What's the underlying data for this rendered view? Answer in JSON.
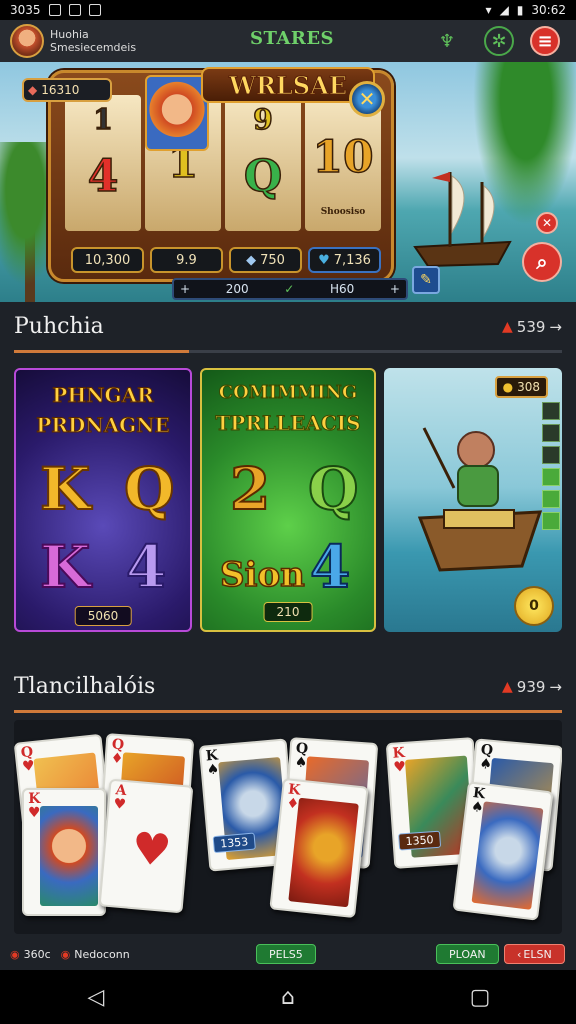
{
  "status_bar": {
    "time_left": "3035",
    "time_right": "30:62"
  },
  "header": {
    "user_name": "Huohia",
    "user_sub": "Smesiecemdeis",
    "brand": "STARES",
    "icons": {
      "trophy": "trophy-icon",
      "settings": "gear-icon",
      "menu": "hamburger-icon"
    }
  },
  "hero": {
    "title": "WRLSAE",
    "jackpot": "16310",
    "reels": [
      {
        "top": "1",
        "main": "4",
        "bottom": "",
        "color": "#e2302a"
      },
      {
        "top": "",
        "main": "1",
        "bottom": "",
        "color": "#e0c020"
      },
      {
        "top": "9",
        "main": "Q",
        "bottom": "",
        "color": "#39b14a"
      },
      {
        "top": "",
        "main": "10",
        "bottom": "Shoosiso",
        "color": "#e8a428"
      }
    ],
    "counters": [
      "10,300",
      "9.9",
      "750",
      "7,136"
    ],
    "bet_left": "+",
    "bet_value": "200",
    "bet_right": "H60",
    "bet_end": "+"
  },
  "section1": {
    "title": "Puhchia",
    "count": "539",
    "arrow": "→"
  },
  "tiles": [
    {
      "title_line1": "PHNGAR",
      "title_line2": "PRDNAGNE",
      "symbols": [
        "K",
        "Q",
        "K",
        "4"
      ],
      "pill": "5060"
    },
    {
      "title_line1": "COMIMMING",
      "title_line2": "TPRLLEACIS",
      "symbols": [
        "2",
        "Q",
        "Sion",
        "4"
      ],
      "pill": "210"
    },
    {
      "badge": "308",
      "coin": "0"
    }
  ],
  "section2": {
    "title": "Tlancilhalóis",
    "count": "939",
    "arrow": "→"
  },
  "card_tags": [
    "1353",
    "1350"
  ],
  "footer": {
    "left1": "360c",
    "left2": "Nedoconn",
    "center_btn": "PELS5",
    "btn_green": "PLOAN",
    "btn_red": "ELSN"
  },
  "colors": {
    "accent_green": "#6fd06a",
    "accent_orange": "#d07a3a",
    "danger": "#d8322a"
  }
}
